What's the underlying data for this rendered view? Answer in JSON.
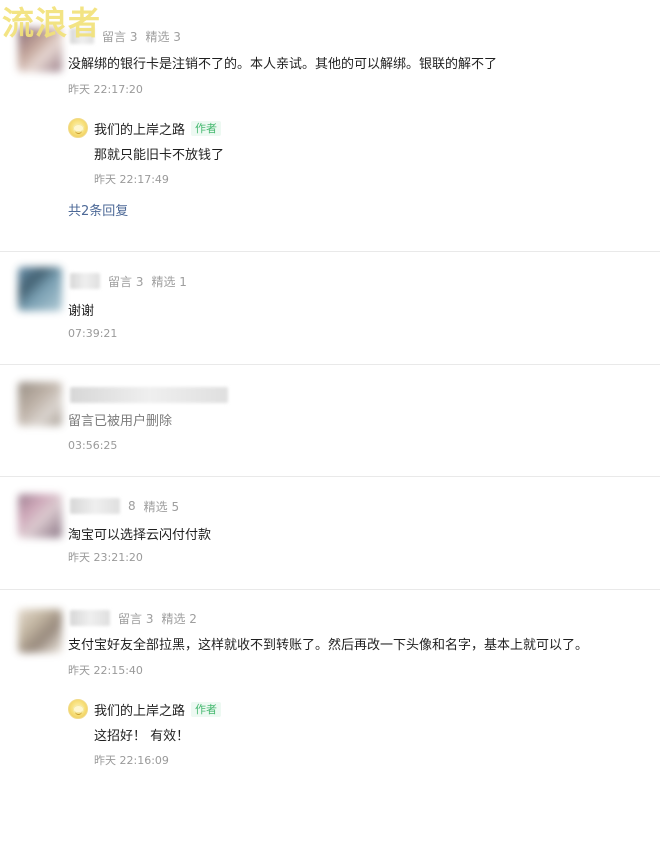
{
  "watermark": "流浪者",
  "comments": [
    {
      "stats_left": "留言 3",
      "stats_right": "精选 3",
      "text": "没解绑的银行卡是注销不了的。本人亲试。其他的可以解绑。银联的解不了",
      "time": "昨天 22:17:20",
      "reply": {
        "author": "我们的上岸之路",
        "badge": "作者",
        "text": "那就只能旧卡不放钱了",
        "time": "昨天 22:17:49"
      },
      "reply_count": "共2条回复"
    },
    {
      "stats_left": "留言 3",
      "stats_right": "精选 1",
      "text": "谢谢",
      "time": "07:39:21"
    },
    {
      "text": "留言已被用户删除",
      "time": "03:56:25"
    },
    {
      "stats_left": "8",
      "stats_right": "精选 5",
      "text": "淘宝可以选择云闪付付款",
      "time": "昨天 23:21:20"
    },
    {
      "stats_left": "留言 3",
      "stats_right": "精选 2",
      "text": "支付宝好友全部拉黑，这样就收不到转账了。然后再改一下头像和名字，基本上就可以了。",
      "time": "昨天 22:15:40",
      "reply": {
        "author": "我们的上岸之路",
        "badge": "作者",
        "text": "这招好！ 有效！",
        "time": "昨天 22:16:09"
      }
    }
  ]
}
